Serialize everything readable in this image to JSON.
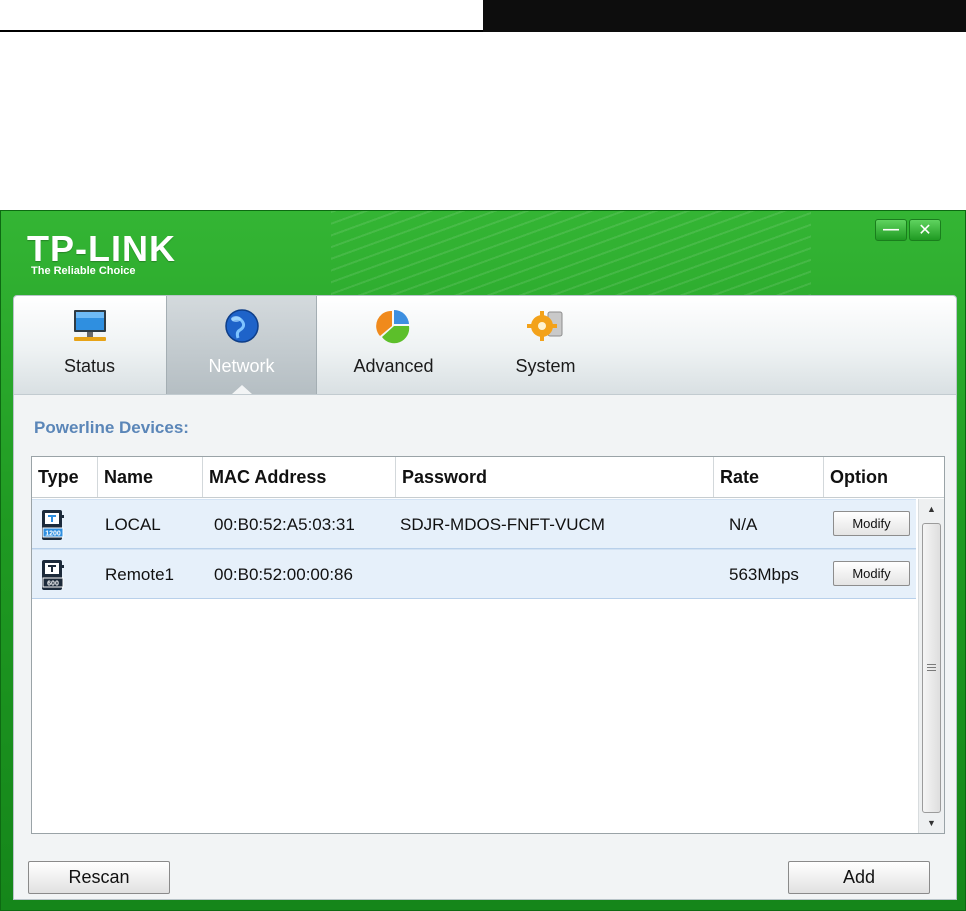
{
  "app": {
    "logo_text": "TP-LINK",
    "logo_tagline": "The Reliable Choice",
    "minimize_label": "—",
    "close_label": "✕"
  },
  "tabs": [
    {
      "label": "Status",
      "icon": "monitor-icon",
      "active": false
    },
    {
      "label": "Network",
      "icon": "globe-icon",
      "active": true
    },
    {
      "label": "Advanced",
      "icon": "pie-chart-icon",
      "active": false
    },
    {
      "label": "System",
      "icon": "gear-icon",
      "active": false
    }
  ],
  "section": {
    "title": "Powerline Devices:"
  },
  "table": {
    "columns": [
      "Type",
      "Name",
      "MAC Address",
      "Password",
      "Rate",
      "Option"
    ],
    "rows": [
      {
        "type_icon": "powerline-1200-icon",
        "type_badge": "1200",
        "name": "LOCAL",
        "mac": "00:B0:52:A5:03:31",
        "password": "SDJR-MDOS-FNFT-VUCM",
        "rate": "N/A",
        "option": "Modify"
      },
      {
        "type_icon": "powerline-600-icon",
        "type_badge": "600",
        "name": "Remote1",
        "mac": "00:B0:52:00:00:86",
        "password": "",
        "rate": "563Mbps",
        "option": "Modify"
      }
    ]
  },
  "buttons": {
    "rescan": "Rescan",
    "add": "Add"
  },
  "colors": {
    "window_green": "#1f9a22",
    "section_title": "#5b86b8",
    "row_highlight": "#e6f0fa",
    "device_icon": "#1c2a3a"
  }
}
